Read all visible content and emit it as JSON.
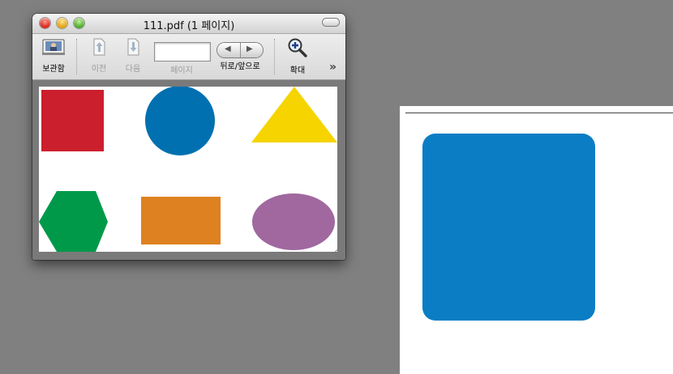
{
  "window": {
    "title": "111.pdf (1 페이지)",
    "toolbar": {
      "drawer_label": "보관함",
      "previous_label": "이전",
      "next_label": "다음",
      "page_label": "페이지",
      "page_value": "",
      "back_forward_label": "뒤로/앞으로",
      "zoom_label": "확대",
      "more_label": "»"
    }
  },
  "document": {
    "shapes": [
      {
        "name": "red-square",
        "color": "#cc1f2d"
      },
      {
        "name": "blue-circle",
        "color": "#0070b0"
      },
      {
        "name": "yellow-triangle",
        "color": "#f5d400"
      },
      {
        "name": "green-hexagon",
        "color": "#00994a"
      },
      {
        "name": "orange-rectangle",
        "color": "#de8120"
      },
      {
        "name": "purple-ellipse",
        "color": "#a0689f"
      }
    ]
  },
  "big_page": {
    "square_color": "#0b7dc4"
  },
  "icons": {
    "drawer": "drawer-photo-icon",
    "previous": "up-arrow-page-icon",
    "next": "down-arrow-page-icon",
    "zoom": "magnifier-plus-icon"
  }
}
